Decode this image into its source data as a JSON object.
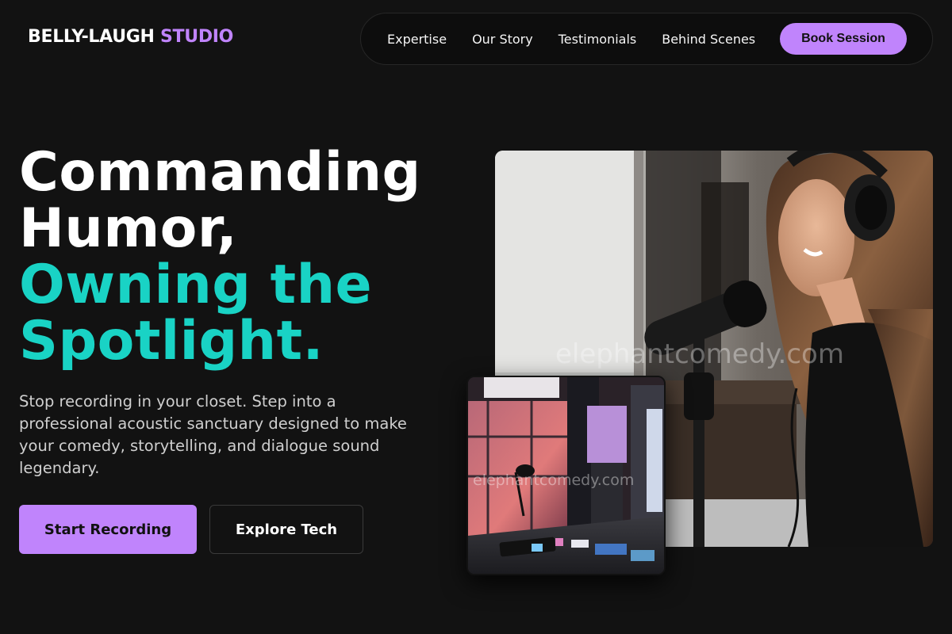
{
  "brand": {
    "name_main": "BELLY-LAUGH",
    "name_accent": "STUDIO"
  },
  "nav": {
    "links": [
      "Expertise",
      "Our Story",
      "Testimonials",
      "Behind Scenes"
    ],
    "cta": "Book Session"
  },
  "hero": {
    "headline_line1": "Commanding",
    "headline_line2": "Humor,",
    "headline_line3": "Owning the",
    "headline_line4": "Spotlight.",
    "description": "Stop recording in your closet. Step into a professional acoustic sanctuary designed to make your comedy, storytelling, and dialogue sound legendary.",
    "primary_button": "Start Recording",
    "secondary_button": "Explore Tech"
  },
  "images": {
    "main_watermark": "elephantcomedy.com",
    "small_watermark": "elephantcomedy.com"
  },
  "colors": {
    "accent_purple": "#c084fc",
    "accent_teal": "#19d3c5",
    "background": "#121212"
  }
}
